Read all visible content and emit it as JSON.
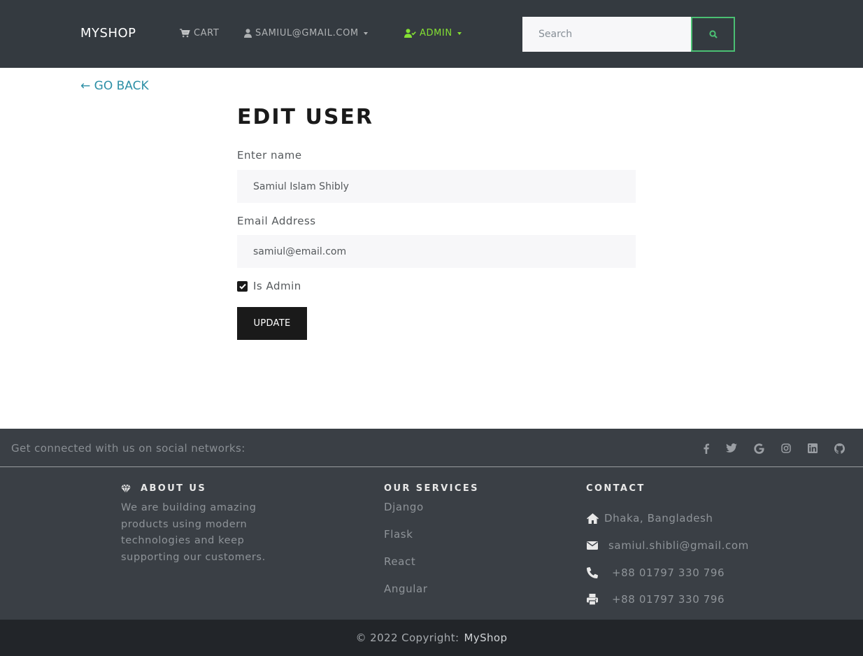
{
  "nav": {
    "brand": "MYSHOP",
    "cart_label": "CART",
    "user_label": "SAMIUL@GMAIL.COM",
    "admin_label": "ADMIN",
    "search_placeholder": "Search"
  },
  "main": {
    "go_back": "← GO BACK",
    "title": "EDIT USER",
    "name_label": "Enter name",
    "name_value": "Samiul Islam Shibly",
    "email_label": "Email Address",
    "email_value": "samiul@email.com",
    "is_admin_label": "Is Admin",
    "is_admin_checked": true,
    "update_label": "UPDATE"
  },
  "footer": {
    "social_text": "Get connected with us on social networks:",
    "social_icons": [
      "facebook-icon",
      "twitter-icon",
      "google-icon",
      "instagram-icon",
      "linkedin-icon",
      "github-icon"
    ],
    "about": {
      "heading": "ABOUT US",
      "text": "We are building amazing products using modern technologies and keep supporting our customers."
    },
    "services": {
      "heading": "OUR SERVICES",
      "items": [
        "Django",
        "Flask",
        "React",
        "Angular"
      ]
    },
    "contact": {
      "heading": "CONTACT",
      "address": "Dhaka, Bangladesh",
      "email": "samiul.shibli@gmail.com",
      "phone": "+88 01797 330 796",
      "fax": "+88 01797 330 796"
    },
    "copyright": "© 2022 Copyright:",
    "copyright_brand": "MyShop"
  },
  "colors": {
    "navbar_bg": "#343a40",
    "accent_green": "#4bbf73",
    "admin_green": "#84e033",
    "link_teal": "#2c8fa6",
    "button_dark": "#1a1a1a",
    "footer_bg": "#3a3f45",
    "copyright_bg": "#222529"
  }
}
